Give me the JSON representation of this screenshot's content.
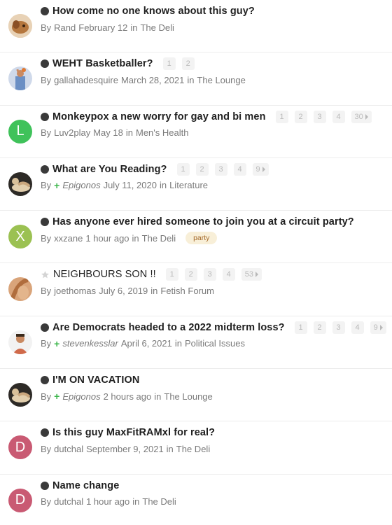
{
  "topics": [
    {
      "title": "How come no one knows about this guy?",
      "by": "By",
      "author": "Rand",
      "date": "February 12",
      "in": "in",
      "forum": "The Deli",
      "pages": [],
      "avatar": {
        "type": "photo",
        "icon": "dog-photo-avatar",
        "color": "#b5773e"
      }
    },
    {
      "title": "WEHT Basketballer?",
      "by": "By",
      "author": "gallahadesquire",
      "date": "March 28, 2021",
      "in": "in",
      "forum": "The Lounge",
      "pages": [
        "1",
        "2"
      ],
      "avatar": {
        "type": "photo",
        "icon": "basketball-player-avatar",
        "color": "#6b8fc4"
      }
    },
    {
      "title": "Monkeypox a new worry for gay and bi men",
      "by": "By",
      "author": "Luv2play",
      "date": "May 18",
      "in": "in",
      "forum": "Men's Health",
      "pages": [
        "1",
        "2",
        "3",
        "4",
        "30"
      ],
      "avatar": {
        "type": "letter",
        "letter": "L",
        "color": "#3fc25a"
      }
    },
    {
      "title": "What are You Reading?",
      "by": "By",
      "author": "Epigonos",
      "date": "July 11, 2020",
      "in": "in",
      "forum": "Literature",
      "pages": [
        "1",
        "2",
        "3",
        "4",
        "9"
      ],
      "avatar": {
        "type": "photo",
        "icon": "reclining-figure-avatar",
        "color": "#caa77e"
      }
    },
    {
      "title": "Has anyone ever hired someone to join you at a circuit party?",
      "by": "By",
      "author": "xxzane",
      "date": "1 hour ago",
      "in": "in",
      "forum": "The Deli",
      "pages": [],
      "tag": "party",
      "avatar": {
        "type": "letter",
        "letter": "X",
        "color": "#9bc152"
      }
    },
    {
      "title": "NEIGHBOURS SON !!",
      "by": "By",
      "author": "joethomas",
      "date": "July 6, 2019",
      "in": "in",
      "forum": "Fetish Forum",
      "pages": [
        "1",
        "2",
        "3",
        "4",
        "53"
      ],
      "avatar": {
        "type": "photo",
        "icon": "tan-photo-avatar",
        "color": "#c9895a"
      }
    },
    {
      "title": "Are Democrats headed to a 2022 midterm loss?",
      "by": "By",
      "author": "stevenkesslar",
      "date": "April 6, 2021",
      "in": "in",
      "forum": "Political Issues",
      "pages": [
        "1",
        "2",
        "3",
        "4",
        "9"
      ],
      "avatar": {
        "type": "photo",
        "icon": "man-photo-avatar",
        "color": "#d06a4a"
      }
    },
    {
      "title": "I'M ON VACATION",
      "by": "By",
      "author": "Epigonos",
      "date": "2 hours ago",
      "in": "in",
      "forum": "The Lounge",
      "pages": [],
      "avatar": {
        "type": "photo",
        "icon": "reclining-figure-avatar",
        "color": "#caa77e"
      }
    },
    {
      "title": "Is this guy MaxFitRAMxl for real?",
      "by": "By",
      "author": "dutchal",
      "date": "September 9, 2021",
      "in": "in",
      "forum": "The Deli",
      "pages": [],
      "avatar": {
        "type": "letter",
        "letter": "D",
        "color": "#c95a73"
      }
    },
    {
      "title": "Name change",
      "by": "By",
      "author": "dutchal",
      "date": "1 hour ago",
      "in": "in",
      "forum": "The Deli",
      "pages": [],
      "avatar": {
        "type": "letter",
        "letter": "D",
        "color": "#c95a73"
      }
    }
  ]
}
